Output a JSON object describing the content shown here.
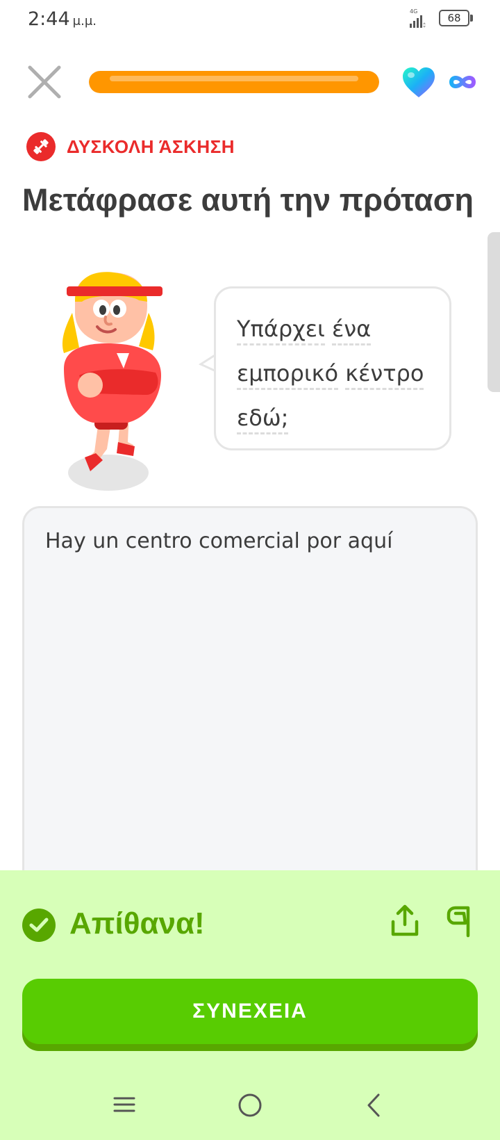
{
  "status_bar": {
    "time": "2:44",
    "ampm": "μ.μ.",
    "network": "4G",
    "battery": "68"
  },
  "header": {
    "progress_fraction": 1.0,
    "progress_color": "#ff9600",
    "hearts": "infinity"
  },
  "exercise": {
    "badge": "ΔΥΣΚΟΛΗ ΆΣΚΗΣΗ",
    "badge_color": "#ea2b2b",
    "title": "Μετάφρασε αυτή την πρόταση",
    "prompt_words": [
      "Υπάρχει",
      "ένα",
      "εμπορικό",
      "κέντρο",
      "εδώ;"
    ],
    "answer": "Hay un centro comercial por aquí"
  },
  "feedback": {
    "title": "Απίθανα!",
    "color": "#58a700",
    "background": "#d7ffb8"
  },
  "actions": {
    "continue_label": "ΣΥΝΕΧΕΙΑ",
    "continue_color": "#58cc02"
  },
  "icons": [
    "close-icon",
    "heart-icon",
    "infinity-icon",
    "dumbbell-icon",
    "check-icon",
    "share-icon",
    "flag-icon",
    "menu-icon",
    "home-icon",
    "back-icon"
  ]
}
